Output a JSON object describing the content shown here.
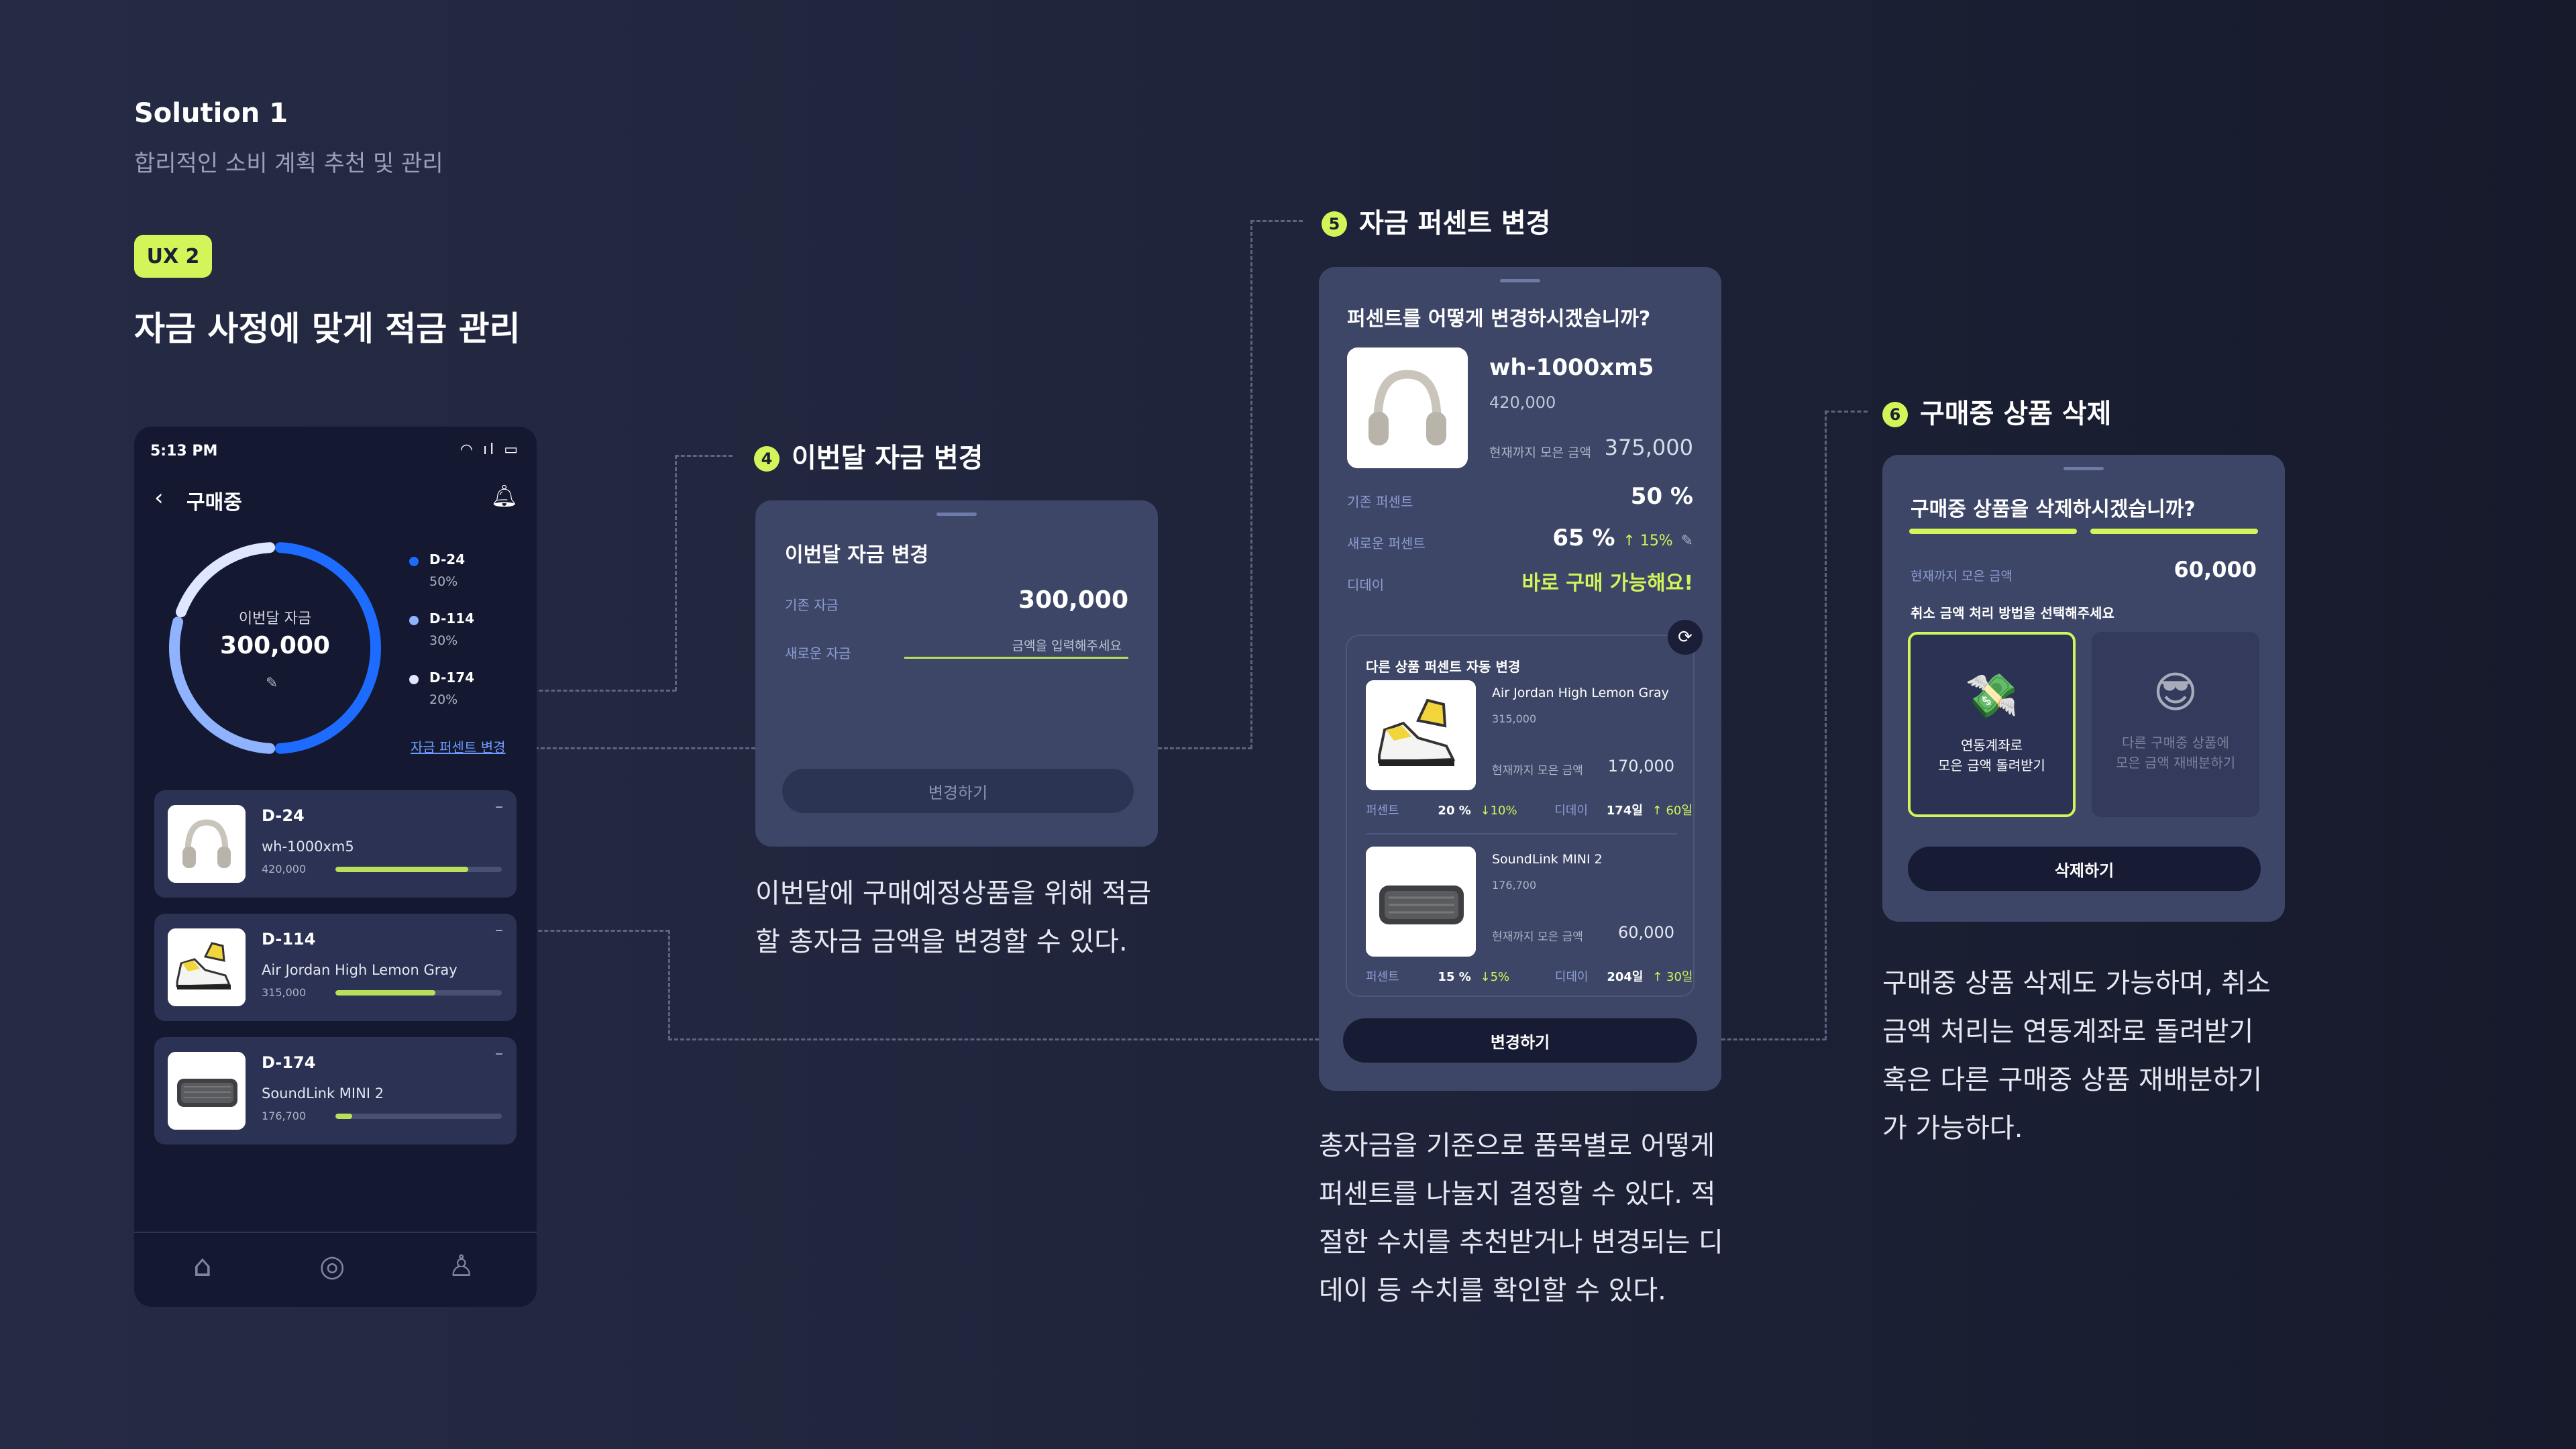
{
  "header": {
    "solution_title": "Solution 1",
    "solution_subtitle": "합리적인 소비 계획 추천 및 관리",
    "badge": "UX 2",
    "main_heading": "자금 사정에 맞게 적금 관리"
  },
  "colors": {
    "accent": "#d4f55a",
    "blue": "#1e6cff",
    "panel": "#3d4666",
    "background": "#1e2339"
  },
  "phone": {
    "time": "5:13 PM",
    "status_icons": "wifi-signal-battery",
    "title": "구매중",
    "donut": {
      "label": "이번달 자금",
      "value": "300,000",
      "segments": [
        {
          "name": "D-24",
          "percent": "50%",
          "fraction": 0.5,
          "color": "#1e6cff"
        },
        {
          "name": "D-114",
          "percent": "30%",
          "fraction": 0.3,
          "color": "#8fb3ff"
        },
        {
          "name": "D-174",
          "percent": "20%",
          "fraction": 0.2,
          "color": "#dfe6ff"
        }
      ]
    },
    "percent_link": "자금 퍼센트 변경",
    "items": [
      {
        "dday": "D-24",
        "name": "wh-1000xm5",
        "price": "420,000",
        "progress": 0.8
      },
      {
        "dday": "D-114",
        "name": "Air Jordan High Lemon Gray",
        "price": "315,000",
        "progress": 0.6
      },
      {
        "dday": "D-174",
        "name": "SoundLink MINI 2",
        "price": "176,700",
        "progress": 0.1
      }
    ],
    "nav": [
      "home-icon",
      "compass-icon",
      "profile-icon"
    ]
  },
  "section4": {
    "number": "4",
    "heading": "이번달 자금 변경",
    "panel_title": "이번달 자금 변경",
    "base_label": "기존 자금",
    "base_value": "300,000",
    "new_label": "새로운 자금",
    "new_placeholder": "금액을 입력해주세요",
    "button": "변경하기",
    "description_1": "이번달에 구매예정상품을 위해 적금",
    "description_2": "할 총자금 금액을 변경할 수 있다."
  },
  "section5": {
    "number": "5",
    "heading": "자금 퍼센트 변경",
    "panel_title": "퍼센트를 어떻게 변경하시겠습니까?",
    "product_name": "wh-1000xm5",
    "product_price": "420,000",
    "saved_label": "현재까지 모은 금액",
    "saved_value": "375,000",
    "old_pct_label": "기존 퍼센트",
    "old_pct_value": "50 %",
    "new_pct_label": "새로운 퍼센트",
    "new_pct_value": "65 %",
    "new_pct_change": "↑ 15%",
    "dday_label": "디데이",
    "dday_value": "바로 구매 가능해요!",
    "auto_title": "다른 상품 퍼센트 자동 변경",
    "others": [
      {
        "name": "Air Jordan High Lemon Gray",
        "price": "315,000",
        "saved_label": "현재까지 모은 금액",
        "saved": "170,000",
        "pct_label": "퍼센트",
        "pct": "20 %",
        "pct_change": "↓10%",
        "dday_label": "디데이",
        "dday": "174일",
        "dday_change": "↑ 60일"
      },
      {
        "name": "SoundLink MINI 2",
        "price": "176,700",
        "saved_label": "현재까지 모은 금액",
        "saved": "60,000",
        "pct_label": "퍼센트",
        "pct": "15 %",
        "pct_change": "↓5%",
        "dday_label": "디데이",
        "dday": "204일",
        "dday_change": "↑ 30일"
      }
    ],
    "button": "변경하기",
    "description_1": "총자금을 기준으로 품목별로 어떻게",
    "description_2": "퍼센트를 나눌지 결정할 수 있다. 적",
    "description_3": "절한 수치를 추천받거나 변경되는 디",
    "description_4": "데이 등 수치를 확인할 수 있다."
  },
  "section6": {
    "number": "6",
    "heading": "구매중 상품 삭제",
    "panel_title": "구매중 상품을 삭제하시겠습니까?",
    "saved_label": "현재까지 모은 금액",
    "saved_value": "60,000",
    "question": "취소 금액 처리 방법을 선택해주세요",
    "option1_line1": "연동계좌로",
    "option1_line2": "모은 금액 돌려받기",
    "option2_line1": "다른 구매중 상품에",
    "option2_line2": "모은 금액 재배분하기",
    "button": "삭제하기",
    "description_1": "구매중 상품 삭제도 가능하며, 취소",
    "description_2": "금액 처리는 연동계좌로 돌려받기",
    "description_3": "혹은 다른 구매중 상품 재배분하기",
    "description_4": "가 가능하다."
  }
}
